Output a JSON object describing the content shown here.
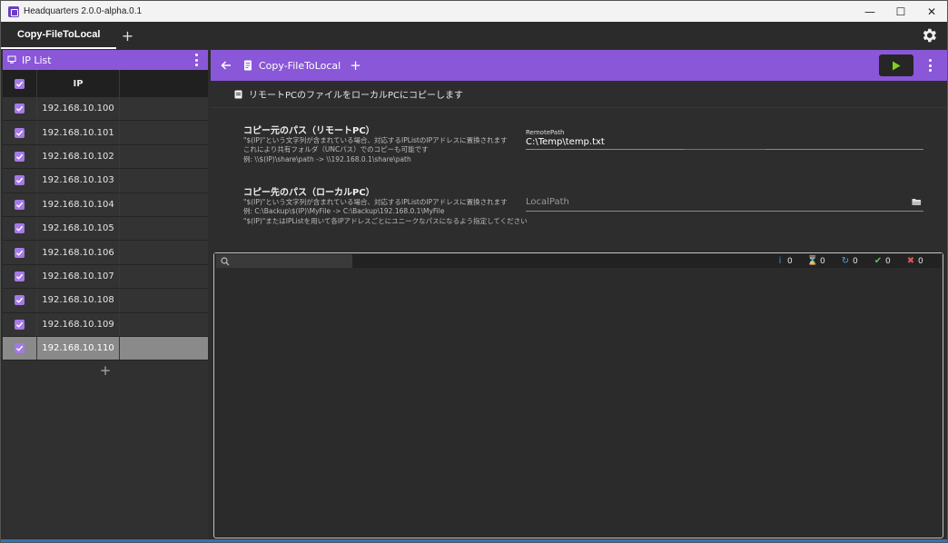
{
  "window": {
    "title": "Headquarters 2.0.0-alpha.0.1",
    "controls": {
      "minimize": "—",
      "maximize": "☐",
      "close": "✕"
    }
  },
  "tabs": [
    {
      "label": "Copy-FileToLocal",
      "active": true
    }
  ],
  "tab_add": "+",
  "ip_list": {
    "title": "IP List",
    "column_header": "IP",
    "rows": [
      {
        "ip": "192.168.10.100",
        "checked": true
      },
      {
        "ip": "192.168.10.101",
        "checked": true
      },
      {
        "ip": "192.168.10.102",
        "checked": true
      },
      {
        "ip": "192.168.10.103",
        "checked": true
      },
      {
        "ip": "192.168.10.104",
        "checked": true
      },
      {
        "ip": "192.168.10.105",
        "checked": true
      },
      {
        "ip": "192.168.10.106",
        "checked": true
      },
      {
        "ip": "192.168.10.107",
        "checked": true
      },
      {
        "ip": "192.168.10.108",
        "checked": true
      },
      {
        "ip": "192.168.10.109",
        "checked": true
      },
      {
        "ip": "192.168.10.110",
        "checked": true,
        "selected": true
      }
    ],
    "add_label": "+"
  },
  "command": {
    "title": "Copy-FileToLocal",
    "add_label": "+",
    "description": "リモートPCのファイルをローカルPCにコピーします",
    "fields": {
      "remote": {
        "label": "コピー元のパス（リモートPC）",
        "help": [
          "\"$(IP)\"という文字列が含まれている場合、対応するIPListのIPアドレスに置換されます",
          "これにより共有フォルダ（UNCパス）でのコピーも可能です",
          "例: \\\\$(IP)\\share\\path -> \\\\192.168.0.1\\share\\path"
        ],
        "caption": "RemotePath",
        "value": "C:\\Temp\\temp.txt"
      },
      "local": {
        "label": "コピー先のパス（ローカルPC）",
        "help": [
          "\"$(IP)\"という文字列が含まれている場合、対応するIPListのIPアドレスに置換されます",
          "例: C:\\Backup\\$(IP)\\MyFile -> C:\\Backup\\192.168.0.1\\MyFile",
          "\"$(IP)\"またはIPListを用いて各IPアドレスごとにユニークなパスになるよう指定してください"
        ],
        "placeholder": "LocalPath"
      }
    }
  },
  "log": {
    "search_placeholder": "",
    "counters": [
      {
        "name": "info",
        "icon": "i",
        "color": "#4a90e2",
        "value": "0"
      },
      {
        "name": "pending",
        "icon": "⌛",
        "color": "#cccccc",
        "value": "0"
      },
      {
        "name": "running",
        "icon": "↻",
        "color": "#4aa3ff",
        "value": "0"
      },
      {
        "name": "success",
        "icon": "✔",
        "color": "#5cc15c",
        "value": "0"
      },
      {
        "name": "error",
        "icon": "✖",
        "color": "#e05555",
        "value": "0"
      }
    ]
  },
  "colors": {
    "accent": "#8a57d8",
    "run": "#7ed321"
  }
}
